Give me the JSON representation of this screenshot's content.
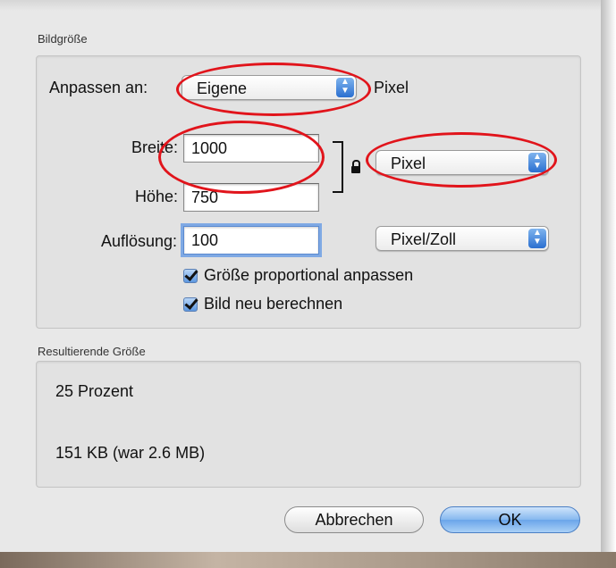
{
  "dialog": {
    "section_image_size": "Bildgröße",
    "fit_label": "Anpassen an:",
    "fit_value": "Eigene",
    "fit_unit": "Pixel",
    "width_label": "Breite:",
    "width_value": "1000",
    "height_label": "Höhe:",
    "height_value": "750",
    "size_unit_value": "Pixel",
    "resolution_label": "Auflösung:",
    "resolution_value": "100",
    "resolution_unit_value": "Pixel/Zoll",
    "checkbox_proportional": {
      "label": "Größe proportional anpassen",
      "checked": true
    },
    "checkbox_resample": {
      "label": "Bild neu berechnen",
      "checked": true
    },
    "section_result": "Resultierende Größe",
    "result_percent": "25 Prozent",
    "result_size": "151 KB (war 2.6 MB)",
    "cancel_label": "Abbrechen",
    "ok_label": "OK"
  },
  "annotations": {
    "highlight_color": "#e1141b",
    "highlights": [
      "fit-popup",
      "width-field",
      "size-unit-popup"
    ]
  },
  "colors": {
    "dialog_bg": "#e8e8e8",
    "accent_blue": "#2b6fd0"
  }
}
